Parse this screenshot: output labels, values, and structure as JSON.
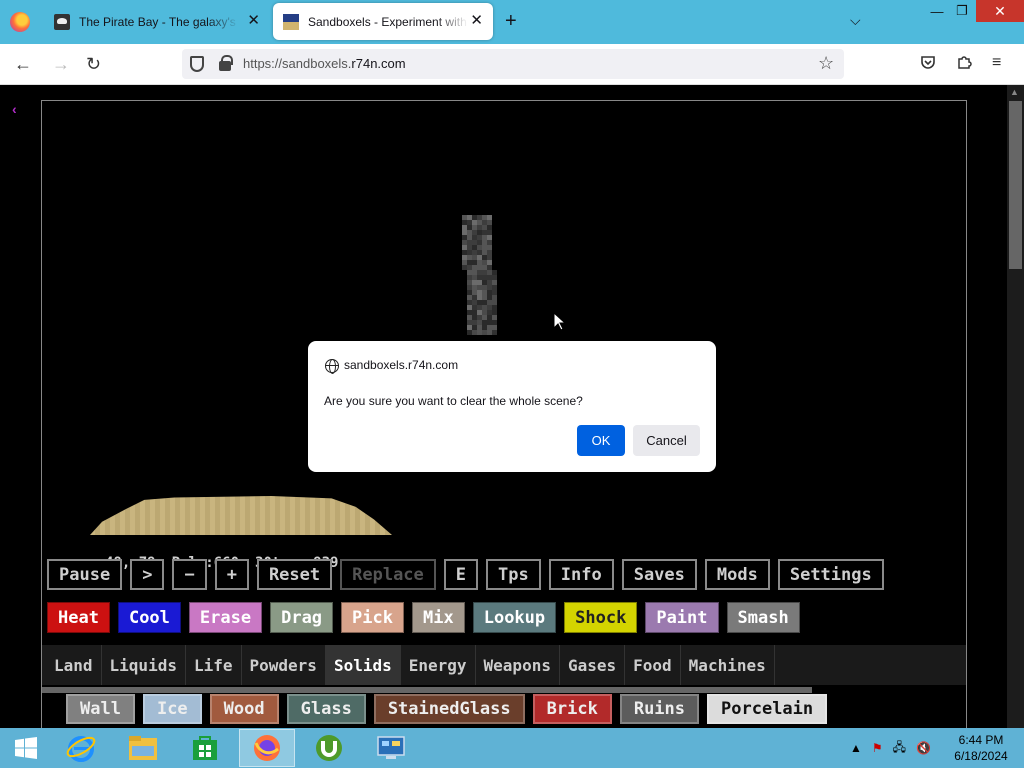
{
  "browser": {
    "tabs": [
      {
        "title": "The Pirate Bay - The galaxy's most resilient BitTorrent site",
        "icon": "pirate-bay-favicon",
        "active": false
      },
      {
        "title": "Sandboxels - Experiment with Pixel Art",
        "icon": "sandboxels-favicon",
        "active": true
      }
    ],
    "url_prefix": "https://sandboxels.",
    "url_domain": "r74n.com",
    "window_controls": {
      "minimize": "—",
      "maximize": "❐",
      "close": "✕"
    },
    "icons": {
      "back": "←",
      "forward": "→",
      "reload": "↻",
      "new_tab": "+",
      "tab_list": "⌵",
      "close_tab": "✕",
      "star": "☆",
      "menu": "≡"
    }
  },
  "game": {
    "back_glyph": "‹",
    "stats": {
      "coords": "x48,y79",
      "pixels": "Pxls:660",
      "tps": "30tps",
      "ticks": "939"
    },
    "controls": [
      "Pause",
      ">",
      "−",
      "+",
      "Reset",
      "Replace",
      "E",
      "Tps",
      "Info",
      "Saves",
      "Mods",
      "Settings"
    ],
    "controls_disabled": [
      5
    ],
    "tools": [
      {
        "label": "Heat",
        "color": "#cc1111"
      },
      {
        "label": "Cool",
        "color": "#1a1ad4"
      },
      {
        "label": "Erase",
        "color": "#c978c4"
      },
      {
        "label": "Drag",
        "color": "#8a9a86"
      },
      {
        "label": "Pick",
        "color": "#d8a48c"
      },
      {
        "label": "Mix",
        "color": "#a3988c"
      },
      {
        "label": "Lookup",
        "color": "#5b7a7e"
      },
      {
        "label": "Shock",
        "color": "#d4d400",
        "text_color": "#222"
      },
      {
        "label": "Paint",
        "color": "#9b7aaf"
      },
      {
        "label": "Smash",
        "color": "#7a7a7a"
      }
    ],
    "categories": [
      "Land",
      "Liquids",
      "Life",
      "Powders",
      "Solids",
      "Energy",
      "Weapons",
      "Gases",
      "Food",
      "Machines"
    ],
    "selected_category": "Solids",
    "elements": [
      {
        "label": "Wall",
        "color": "#808080"
      },
      {
        "label": "Ice",
        "color": "#a3bcd4"
      },
      {
        "label": "Wood",
        "color": "#a15a3e"
      },
      {
        "label": "Glass",
        "color": "#4f6b66"
      },
      {
        "label": "StainedGlass",
        "color": "#6a3e2b"
      },
      {
        "label": "Brick",
        "color": "#b22a2a"
      },
      {
        "label": "Ruins",
        "color": "#5c5c5c"
      },
      {
        "label": "Porcelain",
        "color": "#dcdcdc",
        "text_color": "#111"
      }
    ]
  },
  "dialog": {
    "origin": "sandboxels.r74n.com",
    "message": "Are you sure you want to clear the whole scene?",
    "ok_label": "OK",
    "cancel_label": "Cancel"
  },
  "taskbar": {
    "apps": [
      "start",
      "internet-explorer",
      "file-explorer",
      "store",
      "firefox",
      "utorrent",
      "control-panel"
    ],
    "active_app": "firefox",
    "time": "6:44 PM",
    "date": "6/18/2024"
  }
}
